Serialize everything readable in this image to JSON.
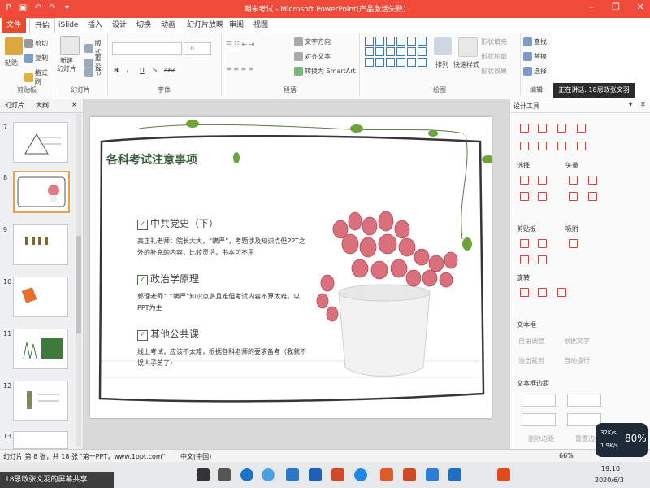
{
  "window": {
    "title": "期末考试 - Microsoft PowerPoint(产品激活失败)",
    "min_symbol": "–",
    "max_symbol": "❐",
    "close_symbol": "✕"
  },
  "ribbon_tabs": [
    "文件",
    "开始",
    "iSlide",
    "插入",
    "设计",
    "切换",
    "动画",
    "幻灯片放映",
    "审阅",
    "视图"
  ],
  "ribbon": {
    "clipboard": {
      "paste": "粘贴",
      "cut": "剪切",
      "copy": "复制",
      "format_painter": "格式刷",
      "label": "剪贴板"
    },
    "slides": {
      "new_slide": "新建\n幻灯片",
      "layout": "版式",
      "reset": "重设",
      "section": "节",
      "label": "幻灯片"
    },
    "font": {
      "font_name": "",
      "font_size": "18",
      "label": "字体",
      "bold": "B",
      "italic": "I",
      "underline": "U",
      "shadow": "S",
      "strike": "abc"
    },
    "paragraph": {
      "text_direction": "文字方向",
      "align_text": "对齐文本",
      "smartart": "转换为 SmartArt",
      "label": "段落"
    },
    "drawing": {
      "arrange": "排列",
      "quick_styles": "快速样式",
      "shape_fill": "形状填充",
      "shape_outline": "形状轮廓",
      "shape_effects": "形状效果",
      "label": "绘图"
    },
    "editing": {
      "find": "查找",
      "replace": "替换",
      "select": "选择",
      "label": "编辑"
    }
  },
  "notification": "正在讲话: 18思政张文羽",
  "left_pane": {
    "tab_slides": "幻灯片",
    "tab_outline": "大纲",
    "close": "×",
    "slide_numbers": [
      "7",
      "8",
      "9",
      "10",
      "11",
      "12",
      "13"
    ]
  },
  "slide": {
    "title": "各科考试注意事项",
    "sections": [
      {
        "heading": "中共党史（下）",
        "body": "高正礼老师：院长大大，“瞒严”，考题涉及知识点但PPT之外的补充的内容，比较灵活，书本可不用"
      },
      {
        "heading": "政治学原理",
        "body": "郭理老师：“瞒严”知识点多且难但考试内容不算太难，以PPT为主"
      },
      {
        "heading": "其他公共课",
        "body": "线上考试，应该不太难，根据各科老师的要求备考（我就不误人子弟了）"
      }
    ]
  },
  "right_pane": {
    "title": "设计工具",
    "select": "选择",
    "vector": "矢量",
    "clipboard": "剪贴板",
    "snap": "吸附",
    "rotate": "旋转",
    "textbox": "文本框",
    "auto_adjust": "自由调整",
    "fit_text": "根据文字",
    "overflow": "溢出裁剪",
    "auto_wrap": "自动换行",
    "margin": "文本框边距",
    "delete_margin": "删除边距",
    "reset": "重置边距"
  },
  "status": {
    "slide_info": "幻灯片 第 8 张，共 18 张",
    "theme": "\"第一PPT，www.1ppt.com\"",
    "language": "中文(中国)",
    "zoom": "66%"
  },
  "speed_widget": {
    "up": "32K/s",
    "down": "1.9K/s",
    "percent": "80%"
  },
  "taskbar": {
    "time": "19:10",
    "date": "2020/6/3",
    "share_label": "18思政张文羽的屏幕共享"
  }
}
